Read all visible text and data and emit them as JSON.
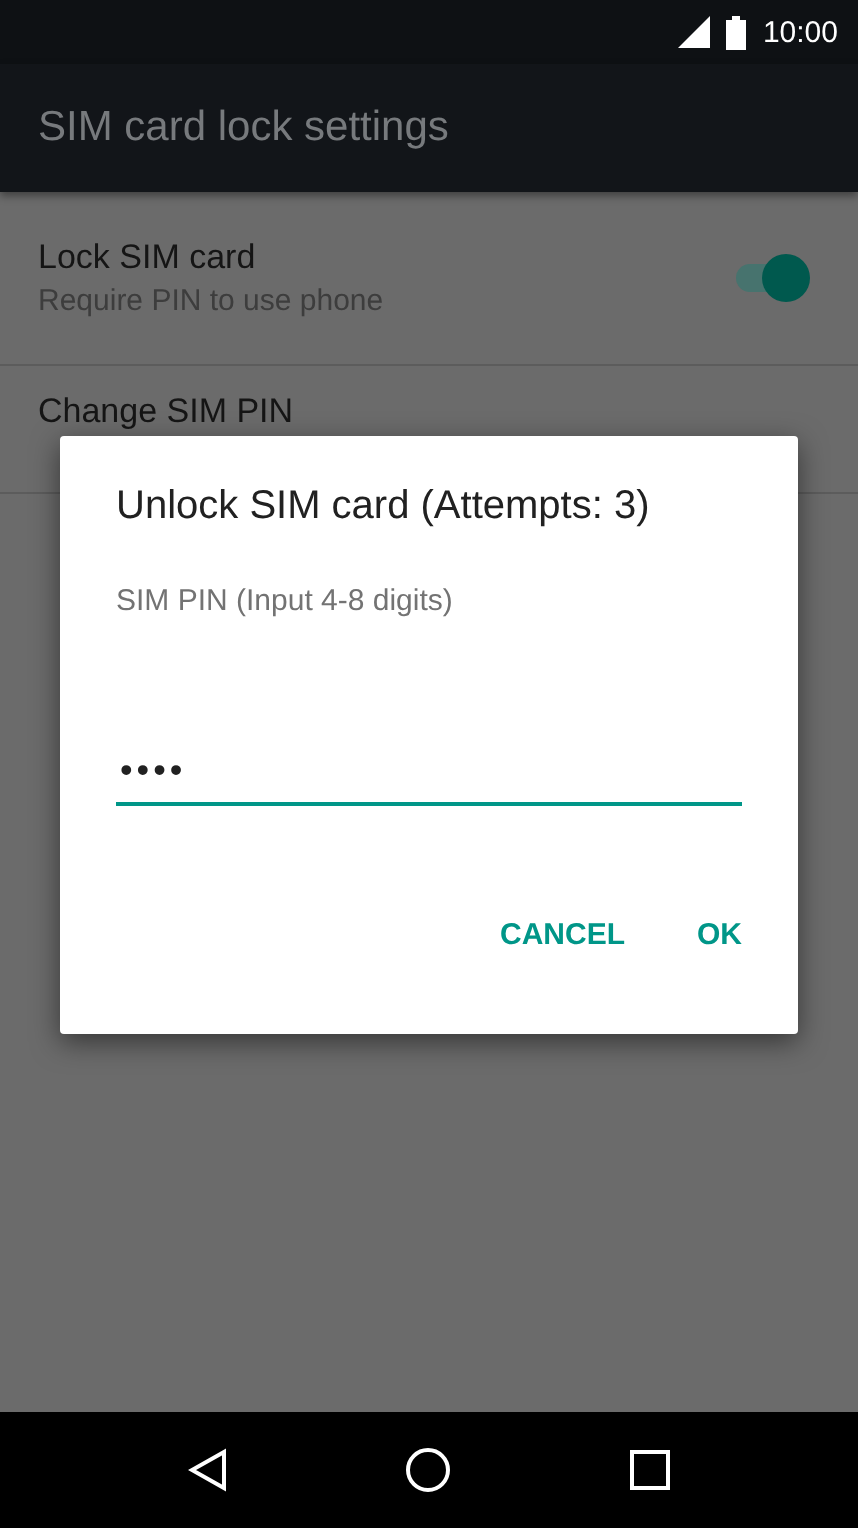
{
  "status_bar": {
    "time": "10:00"
  },
  "app_bar": {
    "title": "SIM card lock settings"
  },
  "settings": [
    {
      "kind": "switch",
      "title": "Lock SIM card",
      "subtitle": "Require PIN to use phone",
      "on": true
    },
    {
      "kind": "plain",
      "title": "Change SIM PIN"
    }
  ],
  "dialog": {
    "title": "Unlock SIM card (Attempts: 3)",
    "label": "SIM PIN (Input 4-8 digits)",
    "value": "••••",
    "buttons": [
      "CANCEL",
      "OK"
    ]
  }
}
